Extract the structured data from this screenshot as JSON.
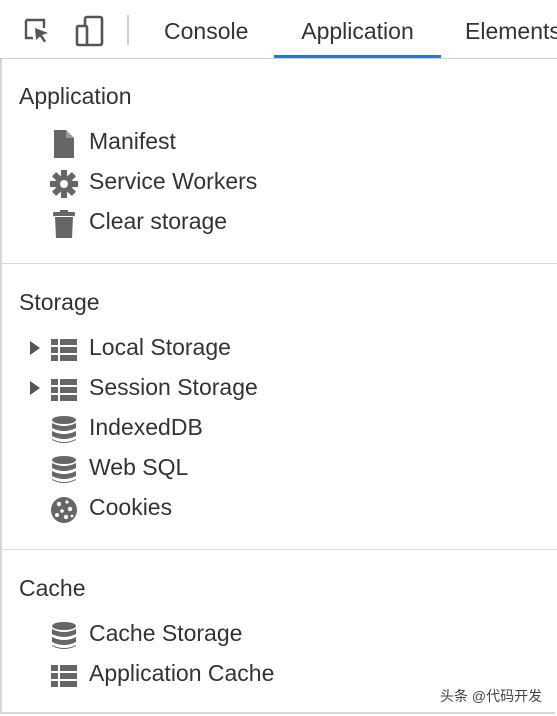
{
  "toolbar": {
    "icons": [
      "select-element-icon",
      "device-toolbar-icon"
    ],
    "tabs": [
      {
        "label": "Console",
        "active": false
      },
      {
        "label": "Application",
        "active": true
      },
      {
        "label": "Elements",
        "active": false
      }
    ],
    "accent_color": "#2a74d2"
  },
  "sections": [
    {
      "title": "Application",
      "items": [
        {
          "label": "Manifest",
          "icon": "file-icon",
          "expandable": false
        },
        {
          "label": "Service Workers",
          "icon": "gear-icon",
          "expandable": false
        },
        {
          "label": "Clear storage",
          "icon": "trash-icon",
          "expandable": false
        }
      ]
    },
    {
      "title": "Storage",
      "items": [
        {
          "label": "Local Storage",
          "icon": "grid-icon",
          "expandable": true
        },
        {
          "label": "Session Storage",
          "icon": "grid-icon",
          "expandable": true
        },
        {
          "label": "IndexedDB",
          "icon": "database-icon",
          "expandable": false
        },
        {
          "label": "Web SQL",
          "icon": "database-icon",
          "expandable": false
        },
        {
          "label": "Cookies",
          "icon": "cookie-icon",
          "expandable": false
        }
      ]
    },
    {
      "title": "Cache",
      "items": [
        {
          "label": "Cache Storage",
          "icon": "database-icon",
          "expandable": false
        },
        {
          "label": "Application Cache",
          "icon": "grid-icon",
          "expandable": false
        }
      ]
    }
  ],
  "watermark": "头条 @代码开发"
}
